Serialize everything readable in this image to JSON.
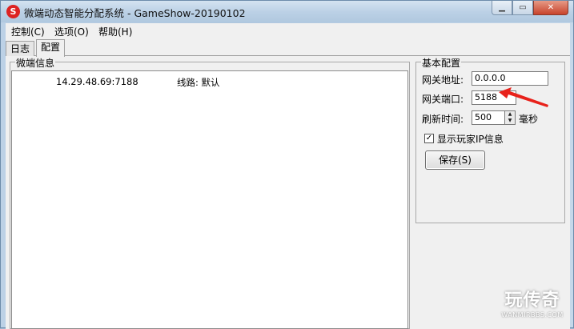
{
  "window": {
    "title": "微端动态智能分配系统 - GameShow-20190102",
    "logo_text": "S"
  },
  "caption_buttons": {
    "minimize": "▁",
    "maximize": "▭",
    "close": "✕"
  },
  "menu": [
    {
      "label": "控制(C)"
    },
    {
      "label": "选项(O)"
    },
    {
      "label": "帮助(H)"
    }
  ],
  "tabs": [
    {
      "label": "日志",
      "active": false
    },
    {
      "label": "配置",
      "active": true
    }
  ],
  "left_group": {
    "label": "微端信息",
    "rows": [
      {
        "address": "14.29.48.69:7188",
        "line": "线路: 默认"
      }
    ]
  },
  "right_group": {
    "label": "基本配置",
    "gateway_address_label": "网关地址:",
    "gateway_address_value": "0.0.0.0",
    "gateway_port_label": "网关端口:",
    "gateway_port_value": "5188",
    "refresh_label": "刷新时间:",
    "refresh_value": "500",
    "refresh_unit": "毫秒",
    "spin_up": "▲",
    "spin_down": "▼",
    "show_ip_label": "显示玩家IP信息",
    "show_ip_checked": "✓",
    "save_button": "保存(S)"
  },
  "annotation": {
    "arrow_color": "#e8221b"
  },
  "watermark": {
    "main": "玩传奇",
    "sub": "WANMIRBBS.COM"
  }
}
